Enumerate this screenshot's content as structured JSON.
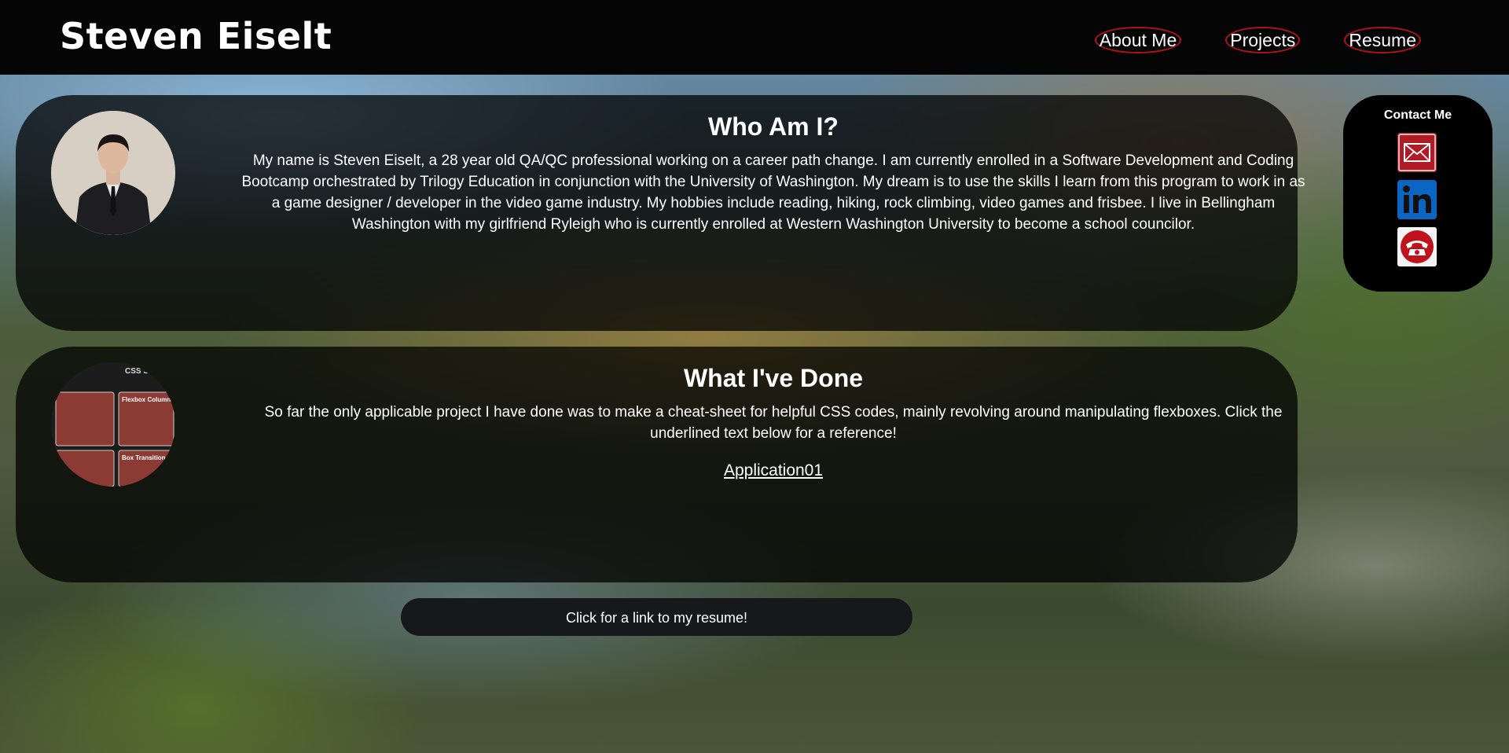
{
  "header": {
    "site_title": "Steven Eiselt",
    "nav": [
      {
        "label": "About Me"
      },
      {
        "label": "Projects"
      },
      {
        "label": "Resume"
      }
    ],
    "nav_border_color": "#b3121c"
  },
  "about": {
    "heading": "Who Am I?",
    "body": "My name is Steven Eiselt, a 28 year old QA/QC professional working on a career path change. I am currently enrolled in a Software Development and Coding Bootcamp orchestrated by Trilogy Education in conjunction with the University of Washington. My dream is to use the skills I learn from this program to work in as a game designer / developer in the video game industry. My hobbies include reading, hiking, rock climbing, video games and frisbee. I live in Bellingham Washington with my girlfriend Ryleigh who is currently enrolled at Western Washington University to become a school councilor."
  },
  "projects": {
    "heading": "What I've Done",
    "body": "So far the only applicable project I have done was to make a cheat-sheet for helpful CSS codes, mainly revolving around manipulating flexboxes. Click the underlined text below for a reference!",
    "link_label": "Application01",
    "thumbnail_texts": {
      "title": "CSS Sn",
      "card1": "Flexbox Column",
      "card2": "Box Transition C"
    }
  },
  "contact": {
    "heading": "Contact Me",
    "icons": [
      "email-icon",
      "linkedin-icon",
      "phone-icon"
    ]
  },
  "resume_button": {
    "label": "Click for a link to my resume!"
  }
}
